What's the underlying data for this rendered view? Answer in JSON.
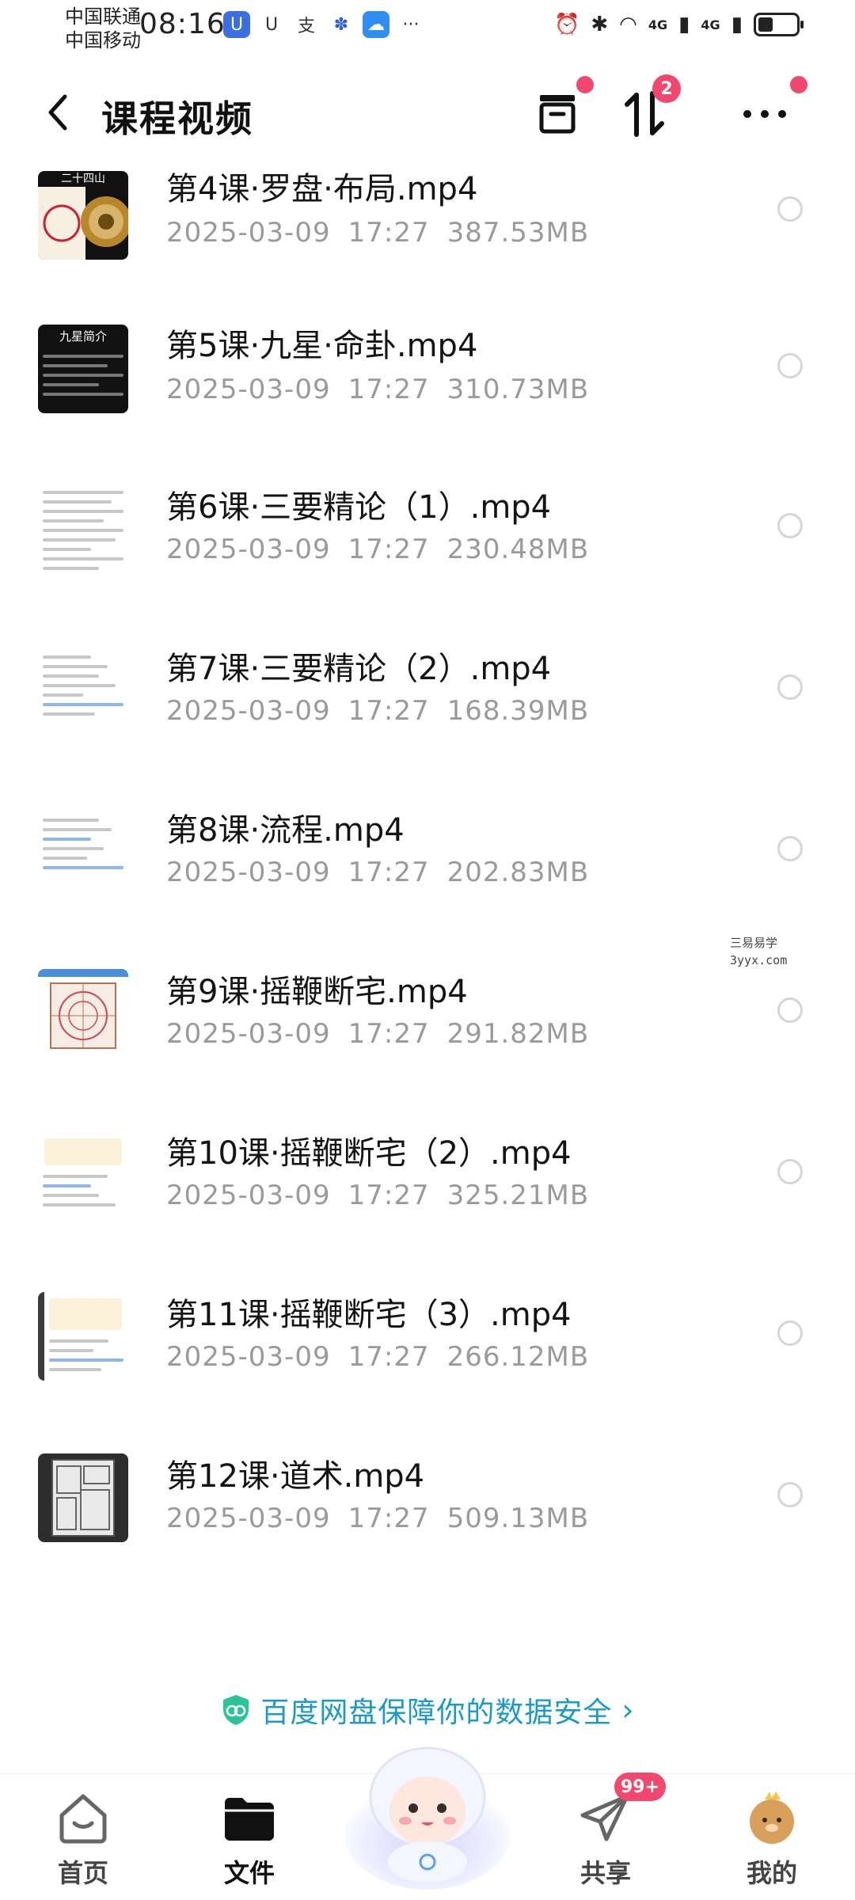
{
  "status_bar": {
    "carrier_1": "中国联通",
    "carrier_2": "中国移动",
    "time": "08:16",
    "signal_1": "4G",
    "signal_2": "4G",
    "overflow_glyph": "···"
  },
  "header": {
    "title": "课程视频",
    "transfer_badge": "2",
    "icons": [
      "back-icon",
      "archive-icon",
      "sort-icon",
      "more-icon"
    ]
  },
  "files": [
    {
      "name": "第4课·罗盘·布局.mp4",
      "date": "2025-03-09",
      "time": "17:27",
      "size": "387.53MB",
      "thumb_text": "二十四山"
    },
    {
      "name": "第5课·九星·命卦.mp4",
      "date": "2025-03-09",
      "time": "17:27",
      "size": "310.73MB",
      "thumb_text": "九星简介"
    },
    {
      "name": "第6课·三要精论（1）.mp4",
      "date": "2025-03-09",
      "time": "17:27",
      "size": "230.48MB"
    },
    {
      "name": "第7课·三要精论（2）.mp4",
      "date": "2025-03-09",
      "time": "17:27",
      "size": "168.39MB"
    },
    {
      "name": "第8课·流程.mp4",
      "date": "2025-03-09",
      "time": "17:27",
      "size": "202.83MB"
    },
    {
      "name": "第9课·摇鞭断宅.mp4",
      "date": "2025-03-09",
      "time": "17:27",
      "size": "291.82MB"
    },
    {
      "name": "第10课·摇鞭断宅（2）.mp4",
      "date": "2025-03-09",
      "time": "17:27",
      "size": "325.21MB"
    },
    {
      "name": "第11课·摇鞭断宅（3）.mp4",
      "date": "2025-03-09",
      "time": "17:27",
      "size": "266.12MB"
    },
    {
      "name": "第12课·道术.mp4",
      "date": "2025-03-09",
      "time": "17:27",
      "size": "509.13MB"
    }
  ],
  "watermark": {
    "line1": "三易易学",
    "line2": "3yyx.com"
  },
  "security_banner": {
    "text": "百度网盘保障你的数据安全",
    "chevron": "›"
  },
  "bottom_nav": {
    "home": "首页",
    "files": "文件",
    "share": "共享",
    "share_badge": "99+",
    "mine": "我的"
  },
  "colors": {
    "accent_pink": "#f2476e",
    "security_blue": "#1a9ac9",
    "meta_gray": "#9a9a9a"
  }
}
